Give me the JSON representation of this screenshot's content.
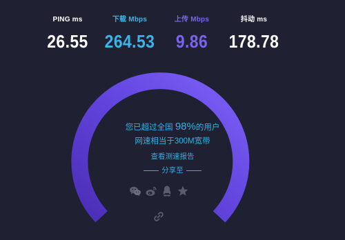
{
  "metrics": {
    "ping": {
      "label": "PING ms",
      "value": "26.55",
      "label_color": "#ffffff",
      "value_color": "#ffffff"
    },
    "download": {
      "label": "下载 Mbps",
      "value": "264.53",
      "label_color": "#3bb4ea",
      "value_color": "#3bb4ea"
    },
    "upload": {
      "label": "上传 Mbps",
      "value": "9.86",
      "label_color": "#7b63ef",
      "value_color": "#7b63ef"
    },
    "jitter": {
      "label": "抖动 ms",
      "value": "178.78",
      "label_color": "#ffffff",
      "value_color": "#ffffff"
    }
  },
  "result": {
    "beat_prefix": "您已超过全国",
    "beat_percent": "98%",
    "beat_suffix": "的用户",
    "equivalent": "网速相当于300M宽带",
    "report_link": "查看测速报告",
    "share_label": "分享至"
  },
  "share_icons": [
    "wechat-icon",
    "weibo-icon",
    "qq-icon",
    "qzone-star-icon"
  ],
  "link_icon": "chain-link-icon",
  "colors": {
    "background": "#1f2132",
    "gauge_start": "#4b2fb8",
    "gauge_end": "#7b5ff5",
    "accent_text": "#33b3e6",
    "icon_gray": "#5a5d6e"
  }
}
